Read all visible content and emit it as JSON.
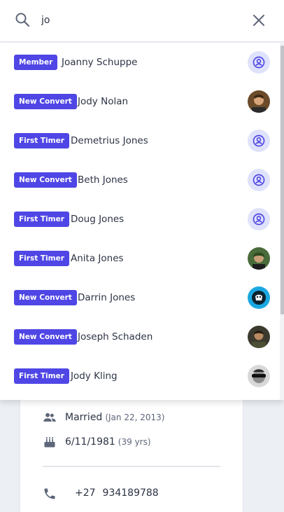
{
  "search": {
    "value": "jo",
    "placeholder": "Search"
  },
  "results": [
    {
      "badge": "Member",
      "name": "Joanny Schuppe",
      "avatar": "placeholder"
    },
    {
      "badge": "New Convert",
      "name": "Jody Nolan",
      "avatar": "photo"
    },
    {
      "badge": "First Timer",
      "name": "Demetrius Jones",
      "avatar": "placeholder"
    },
    {
      "badge": "New Convert",
      "name": "Beth Jones",
      "avatar": "placeholder"
    },
    {
      "badge": "First Timer",
      "name": "Doug Jones",
      "avatar": "placeholder"
    },
    {
      "badge": "First Timer",
      "name": "Anita Jones",
      "avatar": "photo"
    },
    {
      "badge": "New Convert",
      "name": "Darrin Jones",
      "avatar": "photo"
    },
    {
      "badge": "New Convert",
      "name": "Joseph Schaden",
      "avatar": "photo"
    },
    {
      "badge": "First Timer",
      "name": "Jody Kling",
      "avatar": "photo"
    }
  ],
  "profile": {
    "marital_status": "Married",
    "marital_date": "(Jan 22, 2013)",
    "birthday": "6/11/1981",
    "age": "(39 yrs)",
    "phone_code": "+27",
    "phone_number": "934189788"
  },
  "colors": {
    "badge": "#4f46e5",
    "avatar_placeholder_bg": "#dfe2fb",
    "avatar_placeholder_icon": "#4f46e5"
  }
}
